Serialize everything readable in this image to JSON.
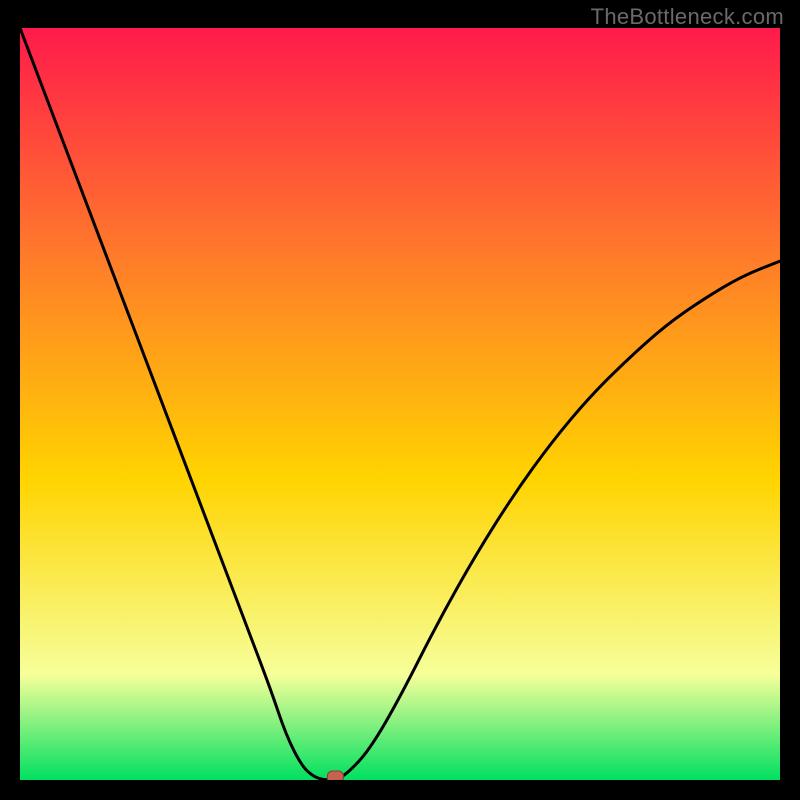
{
  "watermark": "TheBottleneck.com",
  "colors": {
    "bg_frame": "#000000",
    "grad_top": "#ff1a4b",
    "grad_mid1": "#ff7a2a",
    "grad_mid2": "#ffd400",
    "grad_low": "#f6ff9a",
    "grad_bottom": "#00e060",
    "curve": "#000000",
    "marker_fill": "#c9614f",
    "marker_stroke": "#8a3d30"
  },
  "chart_data": {
    "type": "line",
    "title": "",
    "xlabel": "",
    "ylabel": "",
    "xlim": [
      0,
      100
    ],
    "ylim": [
      0,
      100
    ],
    "x": [
      0,
      3,
      6,
      9,
      12,
      15,
      18,
      21,
      24,
      27,
      30,
      33,
      35,
      37,
      38.5,
      40,
      41.5,
      43,
      46,
      50,
      55,
      60,
      65,
      70,
      75,
      80,
      85,
      90,
      95,
      100
    ],
    "values": [
      100,
      92,
      84,
      76,
      68,
      60,
      52,
      44,
      36,
      28,
      20,
      12,
      6,
      2,
      0.5,
      0,
      0,
      0.8,
      4,
      11,
      21,
      30,
      38,
      45,
      51,
      56,
      60.5,
      64,
      67,
      69
    ],
    "marker": {
      "x": 41.5,
      "y": 0
    },
    "baseline_flat": {
      "x_from": 38.5,
      "x_to": 43,
      "y": 0
    },
    "annotations": []
  }
}
